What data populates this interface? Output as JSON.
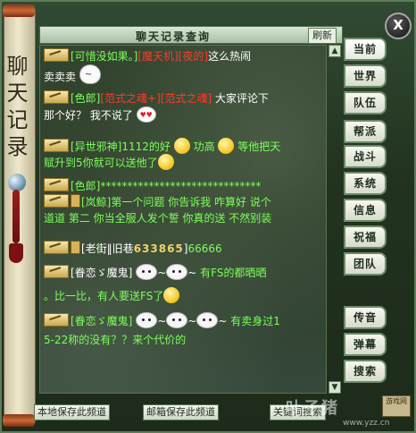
{
  "window": {
    "title": "聊天记录查询",
    "refresh_label": "刷新",
    "close_label": "X",
    "scroll_title": "聊天记录"
  },
  "messages": [
    {
      "sender": "[可惜没如果。]",
      "parts": [
        "[魔天机][夜的]",
        "这么热闹",
        "卖卖卖"
      ]
    },
    {
      "sender": "[色郎]",
      "parts": [
        "[范式之魂+][范式之魂]",
        "大家评论下",
        "那个好？ 我不说了"
      ]
    },
    {
      "sender": "[异世邪神]",
      "parts": [
        "1112的好",
        "功高",
        "等他把天",
        "赋升到5你就可以送他了"
      ]
    },
    {
      "sender": "[色郎]",
      "parts": [
        "******************************"
      ]
    },
    {
      "sender": "[岚鲸]",
      "parts": [
        "第一个问题 你告诉我 咋算好 说个",
        "道道 第二 你当全服人发个誓 你真的送 不然别装"
      ]
    },
    {
      "sender": "[老街‖旧巷",
      "parts": [
        "633865",
        "]",
        "66666"
      ]
    },
    {
      "sender": "[眷恋ゞ魔鬼]",
      "parts": [
        "有FS的都晒晒",
        "。比一比，有人要送FS了"
      ]
    },
    {
      "sender": "[眷恋ゞ魔鬼]",
      "parts": [
        "有卖身过1",
        "5-22称的没有？？来个代价的"
      ]
    }
  ],
  "tabs": [
    "当前",
    "世界",
    "队伍",
    "帮派",
    "战斗",
    "系统",
    "信息",
    "祝福",
    "团队",
    "传音",
    "弹幕",
    "搜索"
  ],
  "bottom_buttons": [
    "本地保存此频道",
    "邮箱保存此频道",
    "关键词搜索"
  ],
  "watermark": {
    "text": "叶子猪",
    "url": "www.yzz.cn",
    "logo": "游戏网"
  },
  "colors": {
    "channel_green": "#7dff5c",
    "highlight_red": "#ff3a2a",
    "text_white": "#ffffff",
    "frame_green": "#314a33"
  },
  "icons": [
    "close-icon",
    "mail-envelope-icon",
    "vip-badge-icon",
    "emoticon-icon",
    "scroll-up-icon",
    "scroll-down-icon"
  ]
}
